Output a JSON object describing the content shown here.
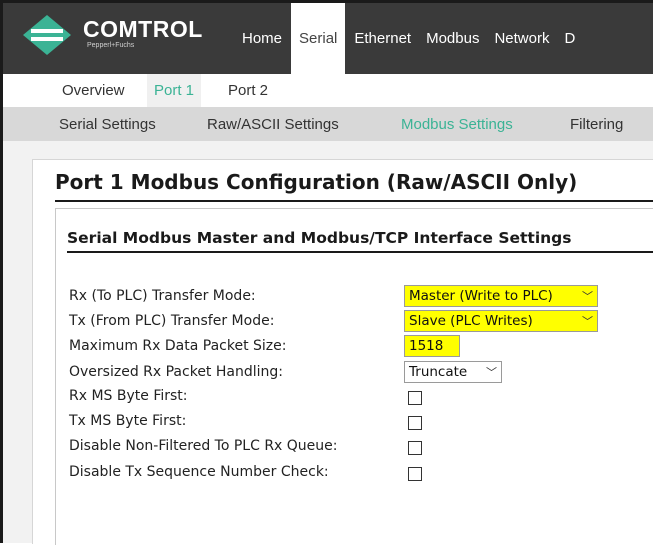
{
  "brand": {
    "name": "COMTROL",
    "tagline": "Pepperl+Fuchs",
    "accent_color": "#3bb395"
  },
  "nav": {
    "items": [
      {
        "label": "Home",
        "active": false
      },
      {
        "label": "Serial",
        "active": true
      },
      {
        "label": "Ethernet",
        "active": false
      },
      {
        "label": "Modbus",
        "active": false
      },
      {
        "label": "Network",
        "active": false
      },
      {
        "label": "D",
        "active": false
      }
    ]
  },
  "subnav": {
    "items": [
      {
        "label": "Overview",
        "active": false
      },
      {
        "label": "Port 1",
        "active": true
      },
      {
        "label": "Port 2",
        "active": false
      }
    ]
  },
  "subsubnav": {
    "items": [
      {
        "label": "Serial Settings",
        "active": false
      },
      {
        "label": "Raw/ASCII Settings",
        "active": false
      },
      {
        "label": "Modbus Settings",
        "active": true
      },
      {
        "label": "Filtering",
        "active": false
      }
    ]
  },
  "page": {
    "title": "Port 1 Modbus Configuration (Raw/ASCII Only)"
  },
  "section": {
    "title": "Serial Modbus Master and Modbus/TCP Interface Settings",
    "fields": {
      "rx_transfer_mode": {
        "label": "Rx (To PLC) Transfer Mode:",
        "value": "Master (Write to PLC)"
      },
      "tx_transfer_mode": {
        "label": "Tx (From PLC) Transfer Mode:",
        "value": "Slave (PLC Writes)"
      },
      "max_rx_packet_size": {
        "label": "Maximum Rx Data Packet Size:",
        "value": "1518"
      },
      "oversized_rx_handling": {
        "label": "Oversized Rx Packet Handling:",
        "value": "Truncate"
      },
      "rx_ms_byte_first": {
        "label": "Rx MS Byte First:",
        "checked": false
      },
      "tx_ms_byte_first": {
        "label": "Tx MS Byte First:",
        "checked": false
      },
      "disable_non_filtered_queue": {
        "label": "Disable Non-Filtered To PLC Rx Queue:",
        "checked": false
      },
      "disable_tx_seq_check": {
        "label": "Disable Tx Sequence Number Check:",
        "checked": false
      }
    }
  }
}
